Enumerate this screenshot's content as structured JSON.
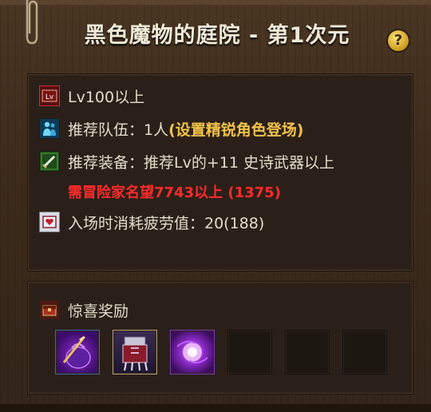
{
  "title": "黑色魔物的庭院 - 第1次元",
  "help_label": "?",
  "info": {
    "level": "Lv100以上",
    "party_label": "推荐队伍：1人",
    "party_note": "(设置精锐角色登场)",
    "gear": "推荐装备：推荐Lv的+11 史诗武器以上",
    "fame": "需冒险家名望7743以上 (1375)",
    "fatigue": "入场时消耗疲劳值：20(188)"
  },
  "rewards": {
    "label": "惊喜奖励",
    "items": [
      {
        "icon": "sack-item-icon",
        "filled": true
      },
      {
        "icon": "armor-item-icon",
        "filled": true
      },
      {
        "icon": "orb-item-icon",
        "filled": true
      },
      {
        "icon": "empty-slot",
        "filled": false
      },
      {
        "icon": "empty-slot",
        "filled": false
      },
      {
        "icon": "empty-slot",
        "filled": false
      }
    ]
  },
  "colors": {
    "note_yellow": "#f2c24a",
    "warning_red": "#ff2b2b",
    "text": "#e3dccb"
  }
}
